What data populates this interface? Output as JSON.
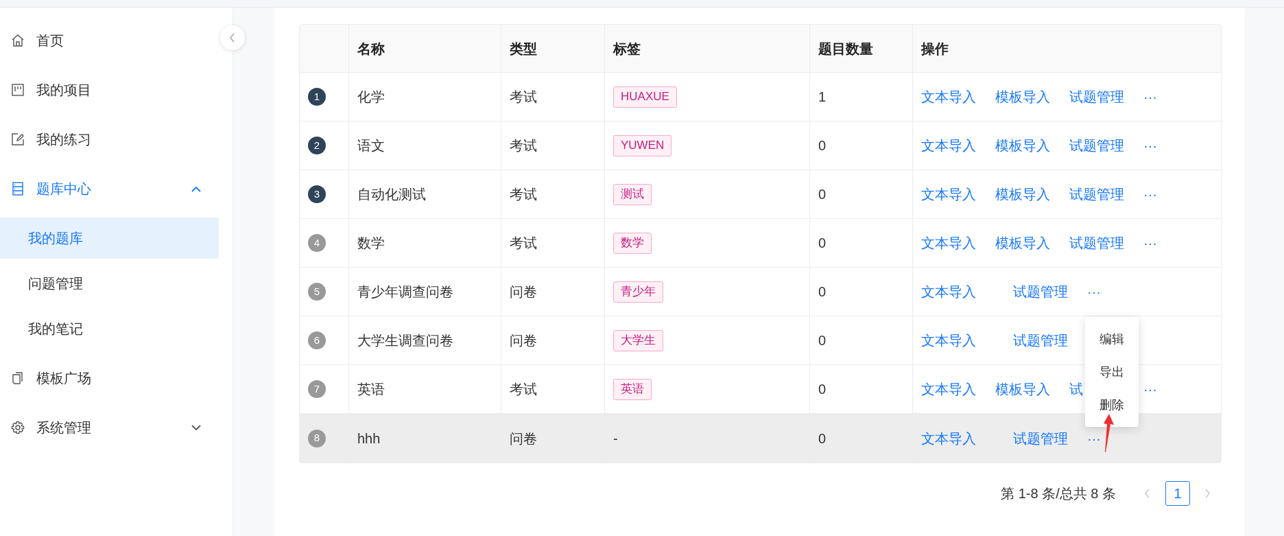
{
  "sidebar": {
    "items": [
      {
        "label": "首页",
        "selected": false
      },
      {
        "label": "我的项目",
        "selected": false
      },
      {
        "label": "我的练习",
        "selected": false
      },
      {
        "label": "题库中心",
        "selected": false,
        "expanded": true,
        "children": [
          {
            "label": "我的题库",
            "selected": true
          },
          {
            "label": "问题管理",
            "selected": false
          },
          {
            "label": "我的笔记",
            "selected": false
          }
        ]
      },
      {
        "label": "模板广场",
        "selected": false
      },
      {
        "label": "系统管理",
        "selected": false,
        "expanded": false
      }
    ]
  },
  "table": {
    "columns": [
      "名称",
      "类型",
      "标签",
      "题目数量",
      "操作"
    ],
    "rows": [
      {
        "index": "1",
        "color": "#2f4459",
        "name": "化学",
        "type": "考试",
        "tag": {
          "kind": "chip",
          "text": "HUAXUE"
        },
        "count": "1",
        "actions": [
          "文本导入",
          "模板导入",
          "试题管理"
        ],
        "more": "···",
        "hovered": false
      },
      {
        "index": "2",
        "color": "#2f4459",
        "name": "语文",
        "type": "考试",
        "tag": {
          "kind": "chip",
          "text": "YUWEN"
        },
        "count": "0",
        "actions": [
          "文本导入",
          "模板导入",
          "试题管理"
        ],
        "more": "···",
        "hovered": false
      },
      {
        "index": "3",
        "color": "#2f4459",
        "name": "自动化测试",
        "type": "考试",
        "tag": {
          "kind": "chip",
          "text": "测试"
        },
        "count": "0",
        "actions": [
          "文本导入",
          "模板导入",
          "试题管理"
        ],
        "more": "···",
        "hovered": false
      },
      {
        "index": "4",
        "color": "#999999",
        "name": "数学",
        "type": "考试",
        "tag": {
          "kind": "chip",
          "text": "数学"
        },
        "count": "0",
        "actions": [
          "文本导入",
          "模板导入",
          "试题管理"
        ],
        "more": "···",
        "hovered": false
      },
      {
        "index": "5",
        "color": "#999999",
        "name": "青少年调查问卷",
        "type": "问卷",
        "tag": {
          "kind": "chip",
          "text": "青少年"
        },
        "count": "0",
        "actions": [
          "文本导入",
          "试题管理"
        ],
        "more": "···",
        "hovered": false
      },
      {
        "index": "6",
        "color": "#999999",
        "name": "大学生调查问卷",
        "type": "问卷",
        "tag": {
          "kind": "chip",
          "text": "大学生"
        },
        "count": "0",
        "actions": [
          "文本导入",
          "试题管理"
        ],
        "hovered": false
      },
      {
        "index": "7",
        "color": "#999999",
        "name": "英语",
        "type": "考试",
        "tag": {
          "kind": "chip",
          "text": "英语"
        },
        "count": "0",
        "actions": [
          "文本导入",
          "模板导入",
          "试"
        ],
        "more": "···",
        "hovered": false
      },
      {
        "index": "8",
        "color": "#999999",
        "name": "hhh",
        "type": "问卷",
        "tag": {
          "kind": "plain",
          "text": "-"
        },
        "count": "0",
        "actions": [
          "文本导入",
          "试题管理"
        ],
        "more": "···",
        "hovered": true
      }
    ]
  },
  "dropdown": {
    "items": [
      "编辑",
      "导出",
      "删除"
    ]
  },
  "pagination": {
    "summary": "第 1-8 条/总共 8 条",
    "prev_disabled": true,
    "pages": [
      {
        "label": "1",
        "selected": true
      }
    ],
    "next_disabled": true
  }
}
